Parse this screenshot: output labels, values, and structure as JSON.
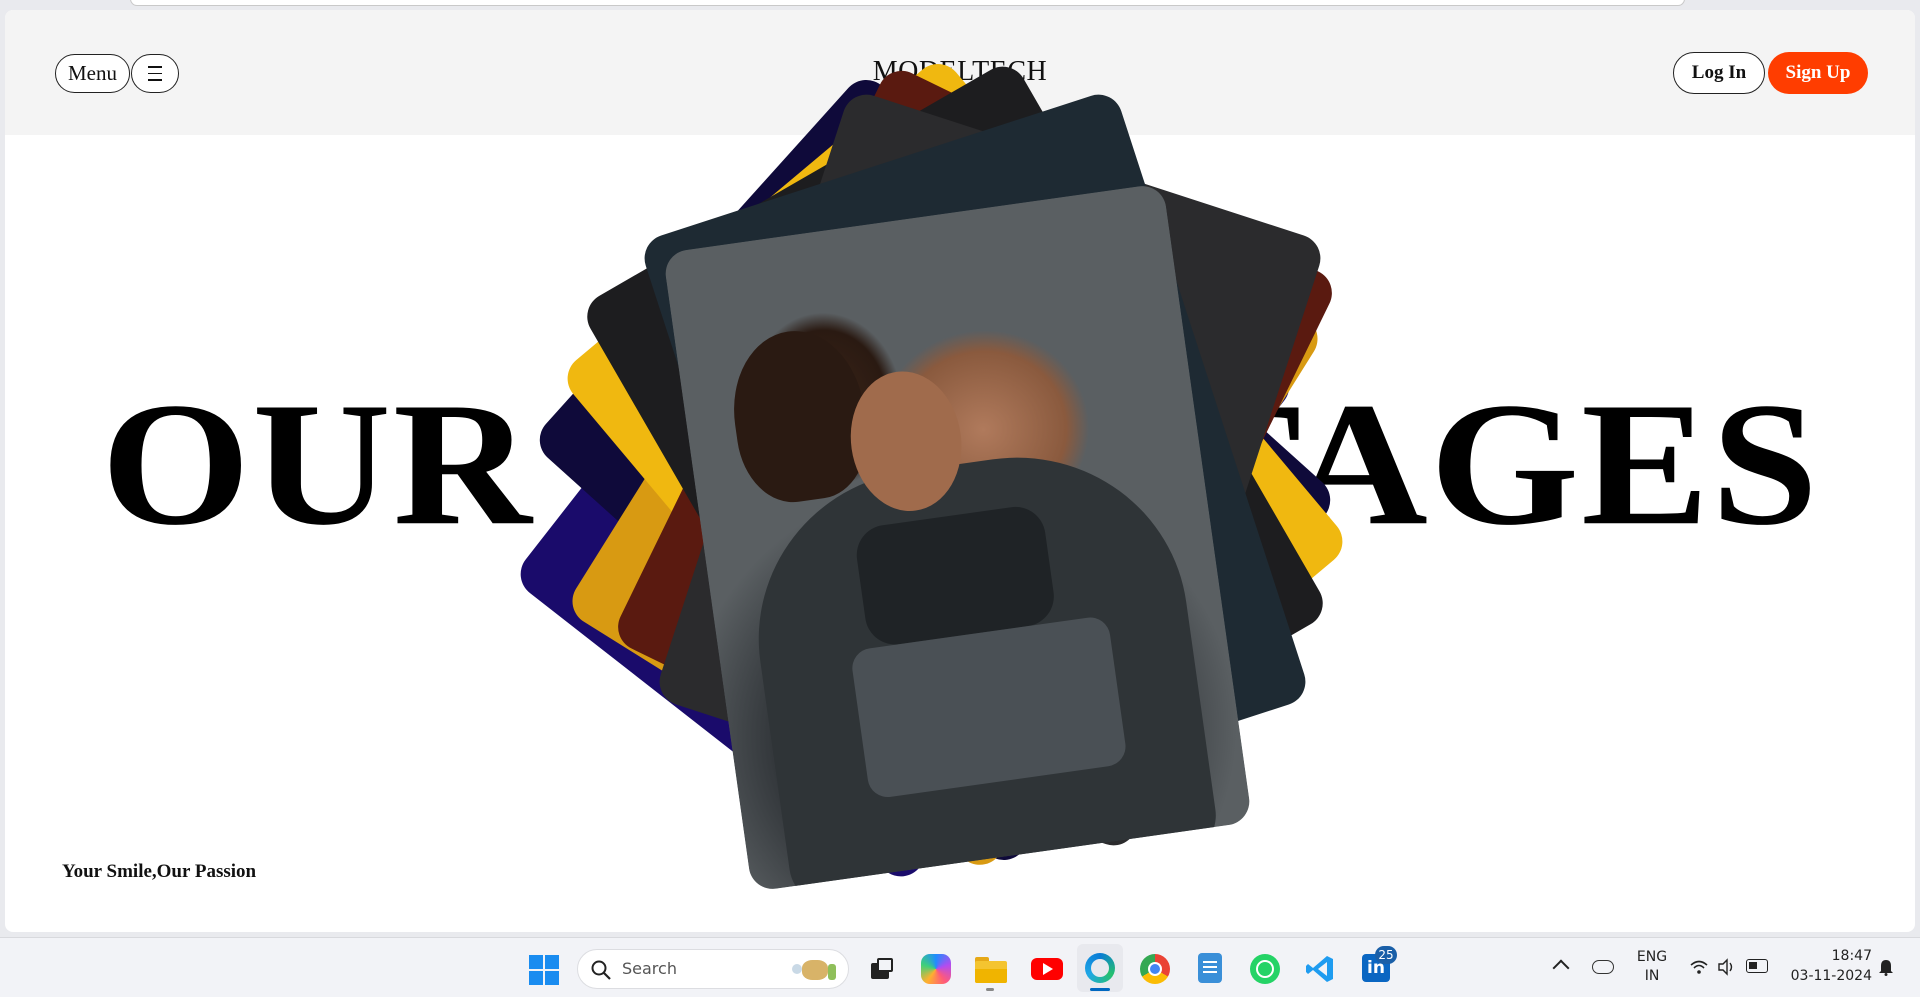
{
  "nav": {
    "menu_label": "Menu",
    "brand": "MODELTECH",
    "login_label": "Log In",
    "signup_label": "Sign Up"
  },
  "hero": {
    "left_word": "OUR A",
    "right_word": "TAGES",
    "tagline": "Your Smile,Our Passion"
  },
  "card_stack": {
    "card_colors": [
      "#1a0b6b",
      "#d89a12",
      "#5a1a10",
      "#1d1d1f",
      "#2b2b2d",
      "#1e2a33",
      "#f0b810",
      "#0f0a3a"
    ],
    "front_card": "photo of two models posing"
  },
  "colors": {
    "accent": "#ff3d00",
    "nav_bg": "#f4f4f4"
  },
  "taskbar": {
    "search_placeholder": "Search",
    "language": "ENG",
    "region": "IN",
    "time": "18:47",
    "date": "03-11-2024",
    "linkedin_badge": "25",
    "apps": [
      "windows-start-icon",
      "task-view-icon",
      "copilot-icon",
      "file-explorer-icon",
      "youtube-icon",
      "edge-icon",
      "chrome-icon",
      "notepad-icon",
      "whatsapp-icon",
      "vscode-icon",
      "linkedin-icon"
    ]
  }
}
